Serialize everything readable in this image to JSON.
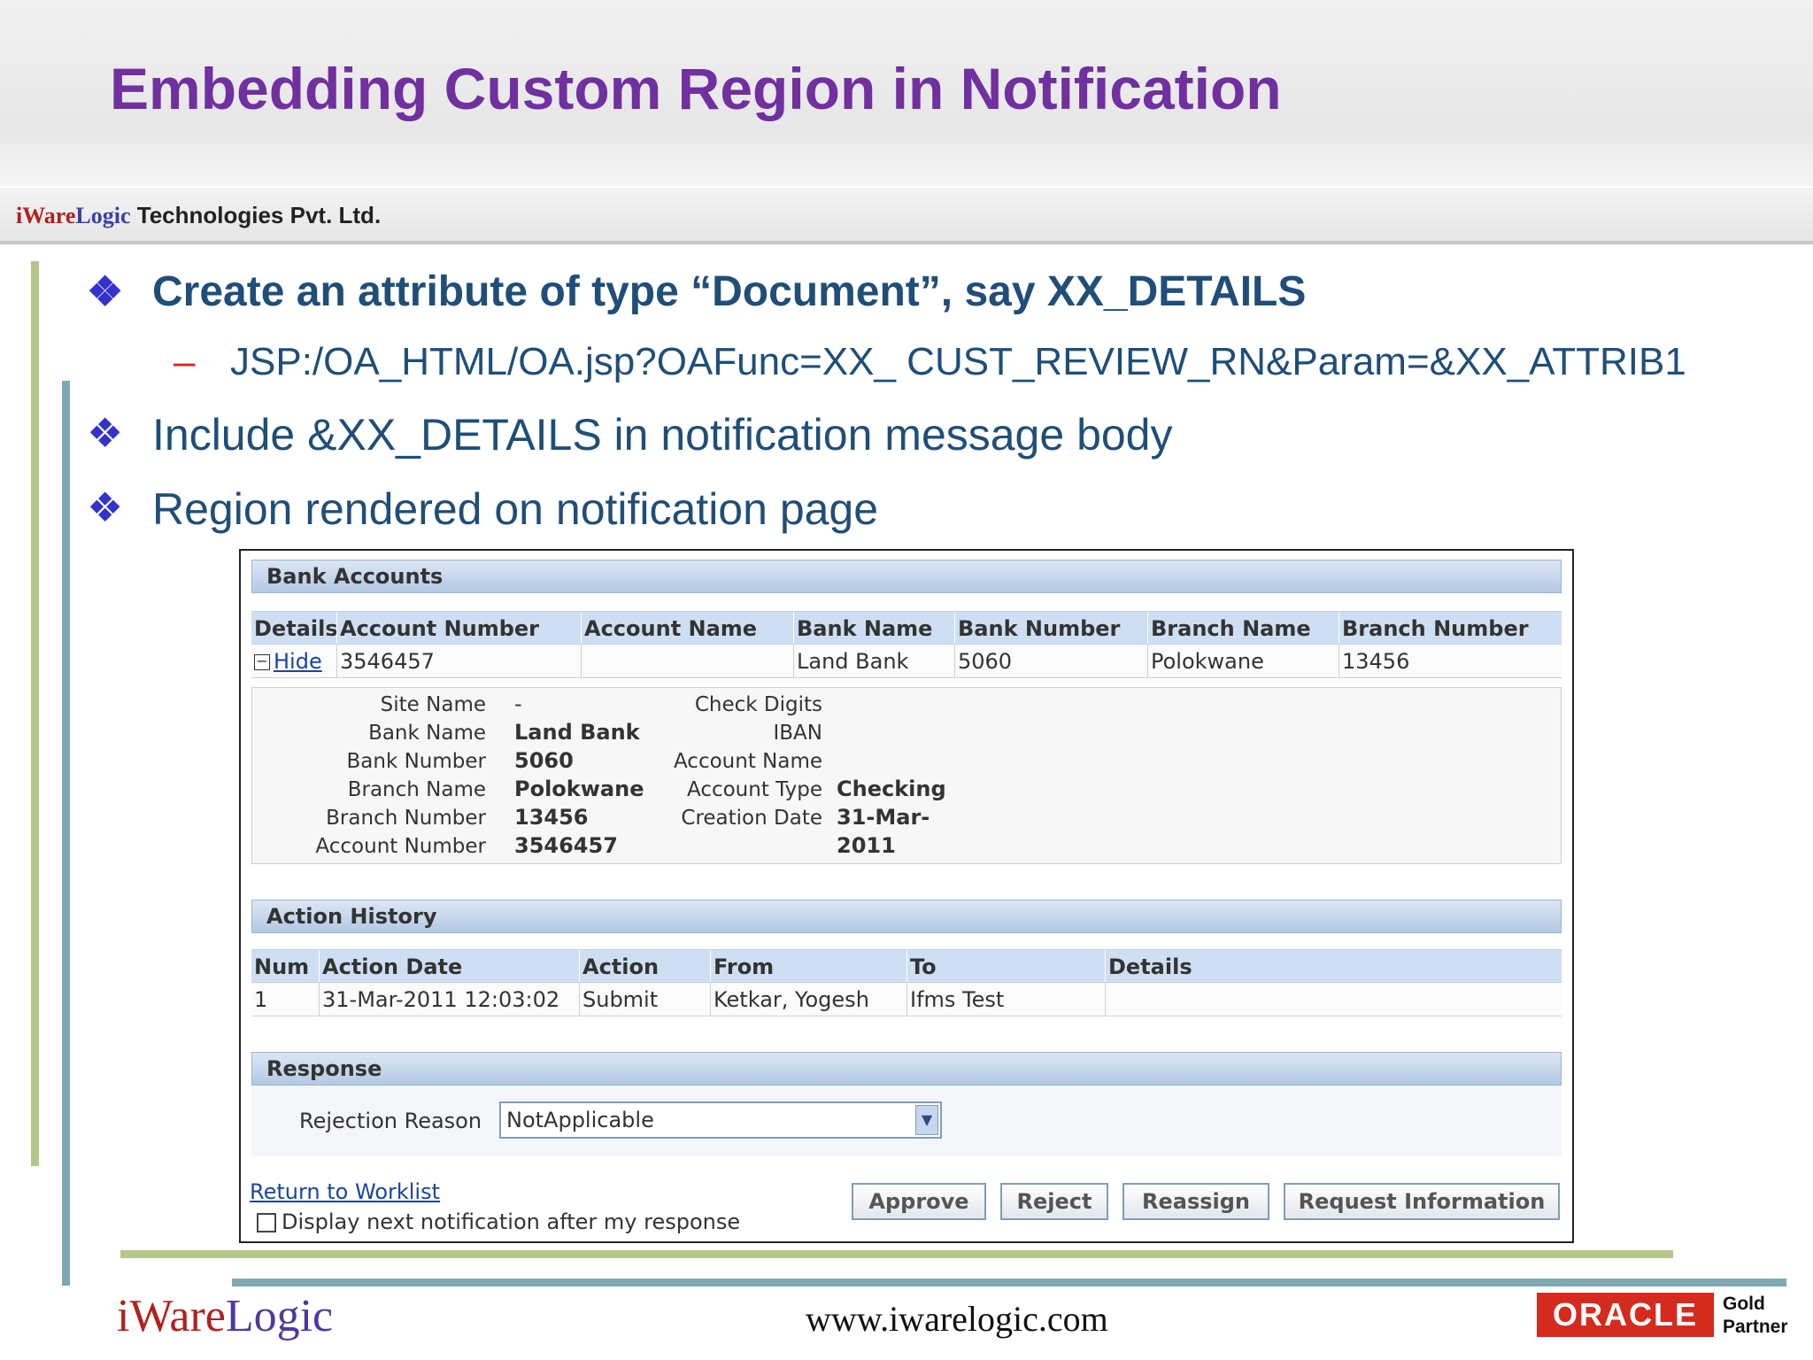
{
  "slide": {
    "title": "Embedding Custom Region in Notification",
    "company_logo_part1": "iWare",
    "company_logo_part2": "Logic",
    "company_rest": " Technologies Pvt. Ltd.",
    "bullet_icon": "diamond-cluster-icon",
    "bullets": [
      {
        "text": "Create an attribute of type “Document”, say XX_DETAILS"
      },
      {
        "text": "Include &XX_DETAILS in notification message body"
      },
      {
        "text": "Region rendered on notification page"
      }
    ],
    "sub_bullet": {
      "dash": "–",
      "text": "JSP:/OA_HTML/OA.jsp?OAFunc=XX_ CUST_REVIEW_RN&Param=&XX_ATTRIB1"
    },
    "colors": {
      "title": "#7030a0",
      "bullet_text": "#1f4e79",
      "bullet_icon": "#3333cc",
      "oracle_red": "#d52b1e"
    }
  },
  "screenshot": {
    "bank_accounts": {
      "header": "Bank Accounts",
      "columns": [
        "Details",
        "Account Number",
        "Account Name",
        "Bank Name",
        "Bank Number",
        "Branch Name",
        "Branch Number"
      ],
      "row": {
        "hide_label": "Hide",
        "account_number": "3546457",
        "account_name": "",
        "bank_name": "Land Bank",
        "bank_number": "5060",
        "branch_name": "Polokwane",
        "branch_number": "13456"
      },
      "details_left": [
        {
          "label": "Site Name",
          "value": "-"
        },
        {
          "label": "Bank Name",
          "value": "Land Bank"
        },
        {
          "label": "Bank Number",
          "value": "5060"
        },
        {
          "label": "Branch Name",
          "value": "Polokwane"
        },
        {
          "label": "Branch Number",
          "value": "13456"
        },
        {
          "label": "Account Number",
          "value": "3546457"
        }
      ],
      "details_right": [
        {
          "label": "Check Digits",
          "value": ""
        },
        {
          "label": "IBAN",
          "value": ""
        },
        {
          "label": "Account Name",
          "value": ""
        },
        {
          "label": "Account Type",
          "value": "Checking"
        },
        {
          "label": "Creation Date",
          "value": "31-Mar-"
        }
      ],
      "creation_date_wrap": "2011"
    },
    "action_history": {
      "header": "Action History",
      "columns": [
        "Num",
        "Action Date",
        "Action",
        "From",
        "To",
        "Details"
      ],
      "row": [
        "1",
        "31-Mar-2011 12:03:02",
        "Submit",
        "Ketkar, Yogesh",
        "Ifms Test",
        ""
      ]
    },
    "response": {
      "header": "Response",
      "rejection_label": "Rejection Reason",
      "rejection_value": "NotApplicable"
    },
    "return_link": "Return to Worklist",
    "checkbox_label": "Display next notification after my response",
    "buttons": {
      "approve": "Approve",
      "reject": "Reject",
      "reassign": "Reassign",
      "request_info": "Request Information"
    }
  },
  "footer": {
    "logo_part1": "iWare",
    "logo_part2": "Logic",
    "url": "www.iwarelogic.com",
    "oracle": "ORACLE",
    "partner_line1": "Gold",
    "partner_line2": "Partner"
  }
}
